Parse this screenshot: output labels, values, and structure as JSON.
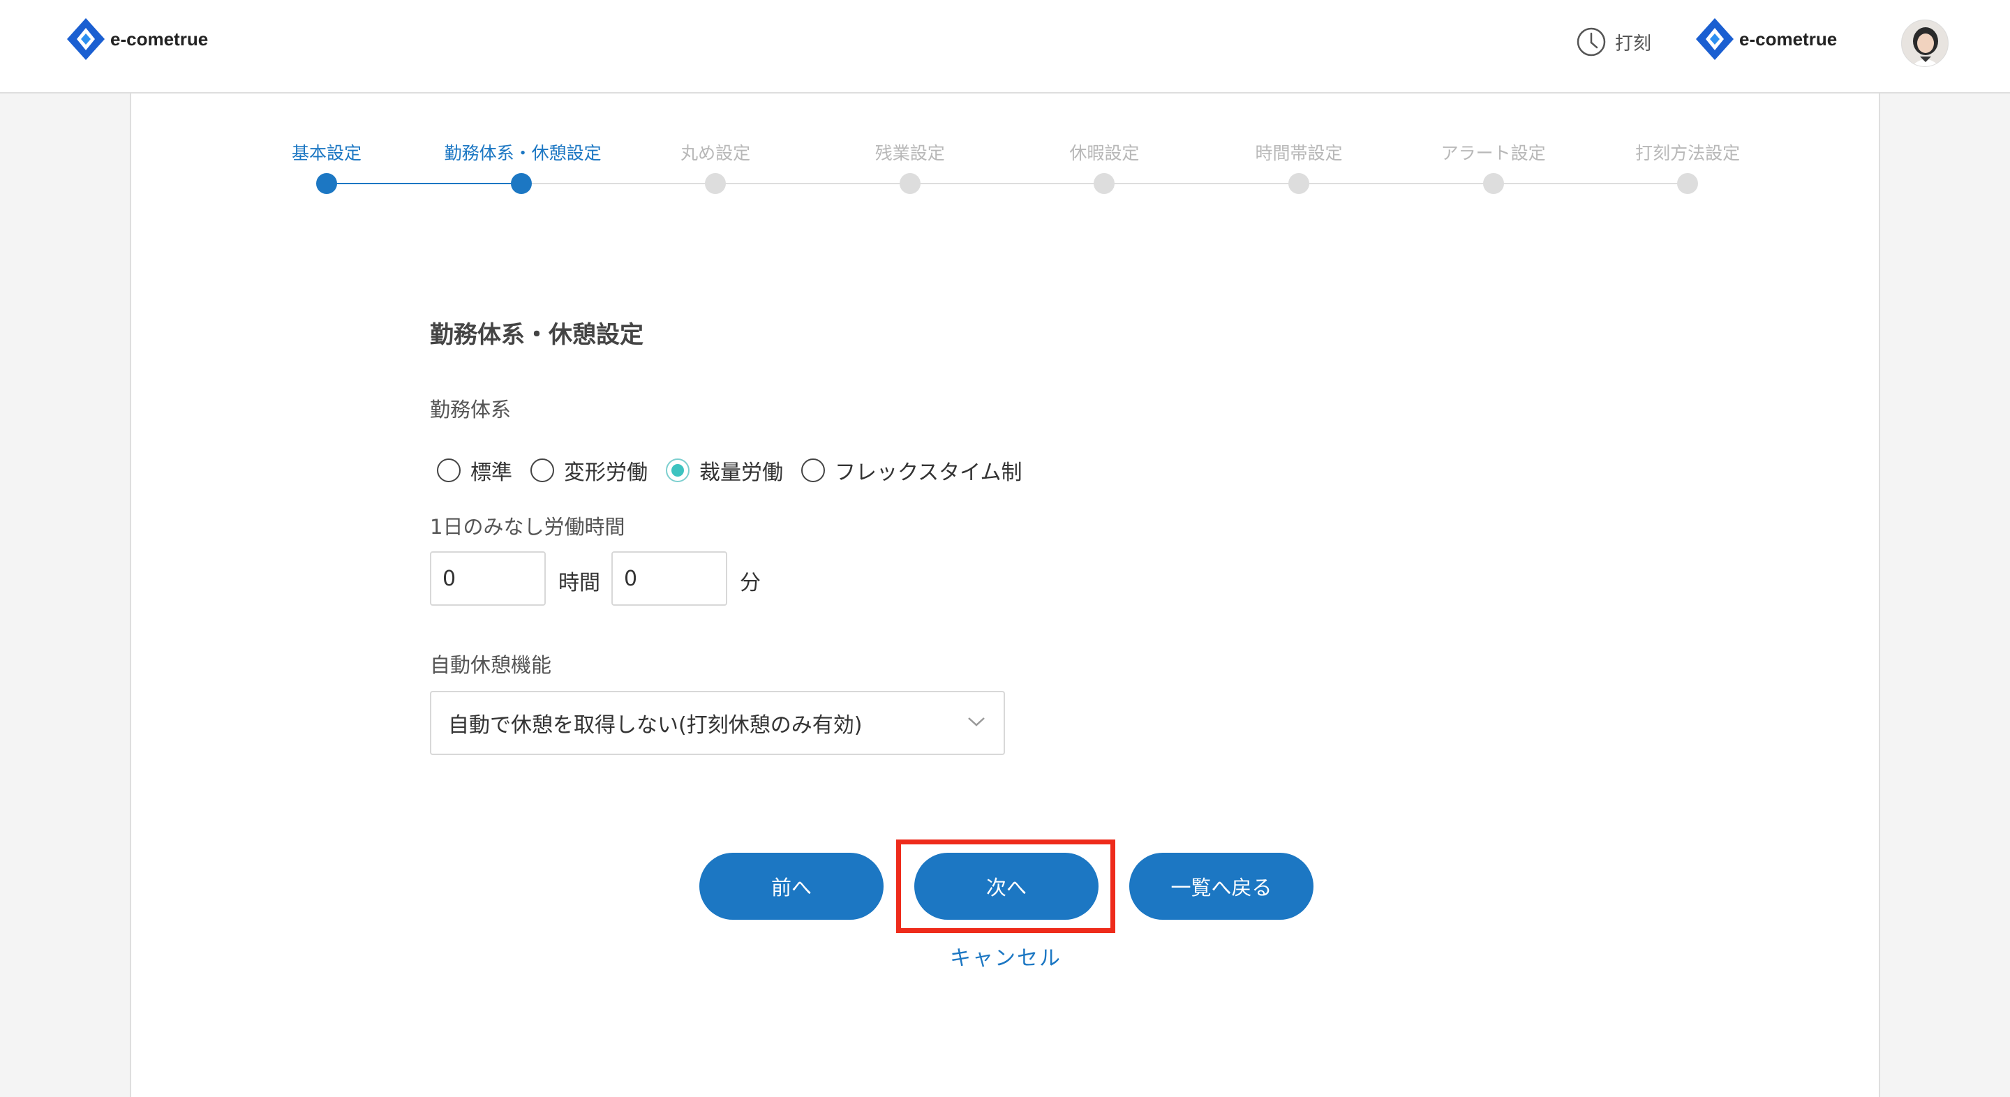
{
  "header": {
    "brand_name": "e-cometrue",
    "punch_label": "打刻",
    "brand_name_right": "e-cometrue"
  },
  "colors": {
    "accent": "#1c77c3",
    "radio_checked": "#3cc3c0",
    "highlight": "#ee2b1b",
    "inactive_step": "#dddddd"
  },
  "stepper": {
    "current_index": 1,
    "steps": [
      {
        "label": "基本設定"
      },
      {
        "label": "勤務体系・休憩設定"
      },
      {
        "label": "丸め設定"
      },
      {
        "label": "残業設定"
      },
      {
        "label": "休暇設定"
      },
      {
        "label": "時間帯設定"
      },
      {
        "label": "アラート設定"
      },
      {
        "label": "打刻方法設定"
      }
    ]
  },
  "form": {
    "section_title": "勤務体系・休憩設定",
    "work_system_label": "勤務体系",
    "work_system_options": [
      {
        "label": "標準",
        "checked": false
      },
      {
        "label": "変形労働",
        "checked": false
      },
      {
        "label": "裁量労働",
        "checked": true
      },
      {
        "label": "フレックスタイム制",
        "checked": false
      }
    ],
    "deemed_hours_label": "1日のみなし労働時間",
    "hours_value": "0",
    "hours_unit": "時間",
    "minutes_value": "0",
    "minutes_unit": "分",
    "auto_break_label": "自動休憩機能",
    "auto_break_selected": "自動で休憩を取得しない(打刻休憩のみ有効)"
  },
  "actions": {
    "prev_label": "前へ",
    "next_label": "次へ",
    "back_to_list_label": "一覧へ戻る",
    "cancel_label": "キャンセル"
  }
}
